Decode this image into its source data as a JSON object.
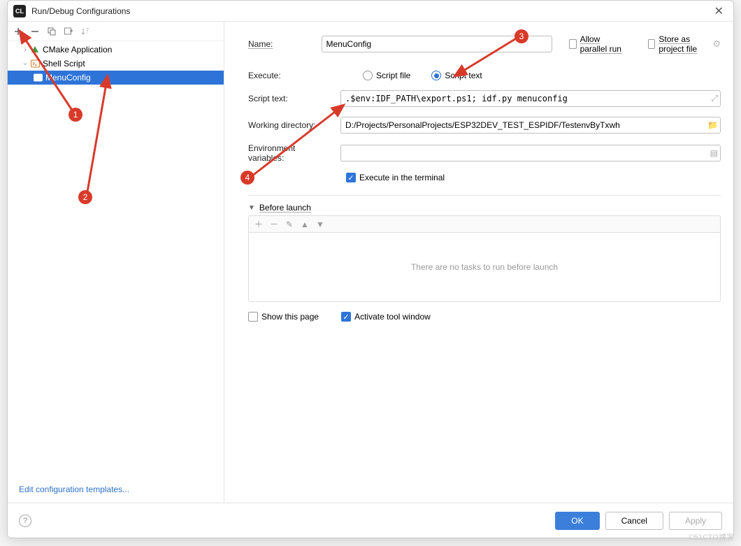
{
  "window": {
    "title": "Run/Debug Configurations"
  },
  "tree": {
    "nodes": [
      {
        "label": "CMake Application",
        "expanded": false
      },
      {
        "label": "Shell Script",
        "expanded": true,
        "children": [
          {
            "label": "MenuConfig",
            "selected": true
          }
        ]
      }
    ]
  },
  "templates_link": "Edit configuration templates...",
  "form": {
    "name_label": "Name:",
    "name_value": "MenuConfig",
    "allow_parallel_label": "Allow parallel run",
    "store_project_label": "Store as project file",
    "execute_label": "Execute:",
    "script_file_label": "Script file",
    "script_text_label": "Script text",
    "script_text_field_label": "Script text:",
    "script_text_value": ".$env:IDF_PATH\\export.ps1; idf.py menuconfig",
    "work_dir_label": "Working directory:",
    "work_dir_value": "D:/Projects/PersonalProjects/ESP32DEV_TEST_ESPIDF/TestenvByTxwh",
    "env_label": "Environment variables:",
    "env_value": "",
    "execute_terminal_label": "Execute in the terminal",
    "before_launch_label": "Before launch",
    "empty_tasks_text": "There are no tasks to run before launch",
    "show_page_label": "Show this page",
    "activate_tool_label": "Activate tool window"
  },
  "footer": {
    "ok": "OK",
    "cancel": "Cancel",
    "apply": "Apply"
  },
  "annotations": {
    "b1": "1",
    "b2": "2",
    "b3": "3",
    "b4": "4"
  },
  "watermark": "©51CTO博客"
}
